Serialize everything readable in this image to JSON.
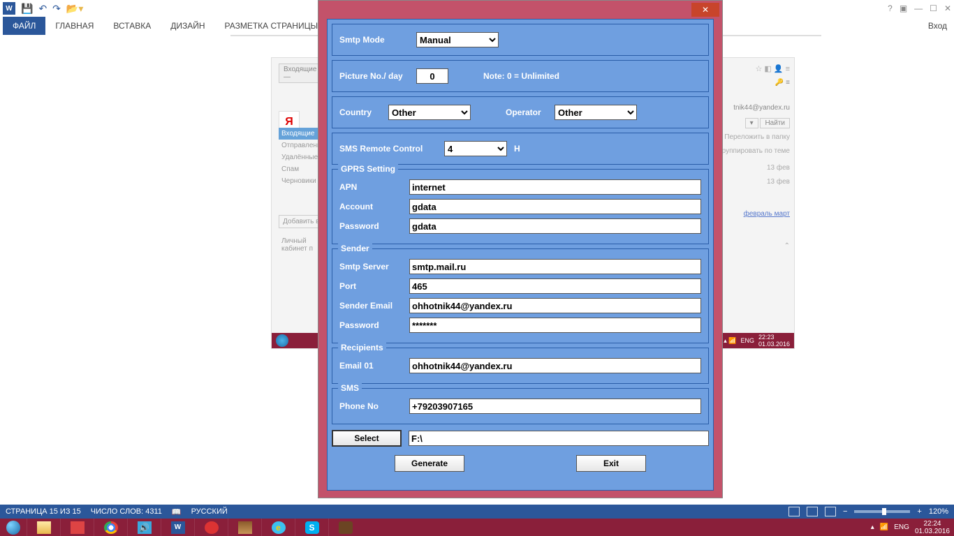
{
  "qat": {
    "word": "W"
  },
  "ribbon": {
    "file": "ФАЙЛ",
    "home": "ГЛАВНАЯ",
    "insert": "ВСТАВКА",
    "design": "ДИЗАЙН",
    "layout": "РАЗМЕТКА СТРАНИЦЫ",
    "login": "Вход"
  },
  "bg": {
    "inbox_tab": "Входящие —",
    "yandex": "Я",
    "folders": {
      "inbox": "Входящие",
      "sent": "Отправленные",
      "deleted": "Удалённые",
      "spam": "Спам",
      "drafts": "Черновики"
    },
    "add_btn": "Добавить ва",
    "cabinet": "Личный кабинет п",
    "email": "tnik44@yandex.ru",
    "find": "Найти",
    "move": "Переложить в папку",
    "group": "группировать по теме",
    "date1": "13 фев",
    "date2": "13 фев",
    "months": "февраль  март",
    "lang": "ENG",
    "time": "22:23",
    "date": "01.03.2016"
  },
  "dlg": {
    "smtp_mode_lbl": "Smtp Mode",
    "smtp_mode_val": "Manual",
    "pic_lbl": "Picture No./ day",
    "pic_val": "0",
    "pic_note": "Note: 0 = Unlimited",
    "country_lbl": "Country",
    "country_val": "Other",
    "operator_lbl": "Operator",
    "operator_val": "Other",
    "sms_rc_lbl": "SMS Remote Control",
    "sms_rc_val": "4",
    "sms_rc_unit": "H",
    "gprs_legend": "GPRS Setting",
    "apn_lbl": "APN",
    "apn_val": "internet",
    "acct_lbl": "Account",
    "acct_val": "gdata",
    "pwd_lbl": "Password",
    "pwd_val": "gdata",
    "sender_legend": "Sender",
    "smtp_srv_lbl": "Smtp Server",
    "smtp_srv_val": "smtp.mail.ru",
    "port_lbl": "Port",
    "port_val": "465",
    "semail_lbl": "Sender Email",
    "semail_val": "ohhotnik44@yandex.ru",
    "spwd_lbl": "Password",
    "spwd_val": "*******",
    "recip_legend": "Recipients",
    "email01_lbl": "Email 01",
    "email01_val": "ohhotnik44@yandex.ru",
    "sms_legend": "SMS",
    "phone_lbl": "Phone No",
    "phone_val": "+79203907165",
    "select_btn": "Select",
    "path_val": "F:\\",
    "generate_btn": "Generate",
    "exit_btn": "Exit"
  },
  "status": {
    "page": "СТРАНИЦА 15 ИЗ 15",
    "words": "ЧИСЛО СЛОВ: 4311",
    "lang": "РУССКИЙ",
    "zoom": "120%"
  },
  "task": {
    "lang": "ENG",
    "time": "22:24",
    "date": "01.03.2016"
  }
}
